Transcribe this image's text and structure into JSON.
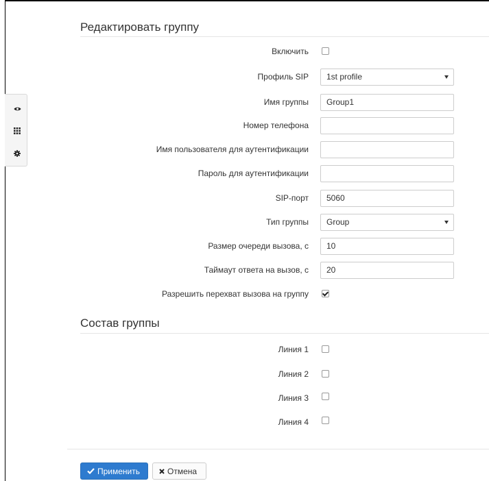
{
  "edit_group": {
    "title": "Редактировать группу",
    "fields": {
      "enable": {
        "label": "Включить",
        "checked": false
      },
      "sip_profile": {
        "label": "Профиль SIP",
        "value": "1st profile"
      },
      "group_name": {
        "label": "Имя группы",
        "value": "Group1"
      },
      "phone_number": {
        "label": "Номер телефона",
        "value": ""
      },
      "auth_username": {
        "label": "Имя пользователя для аутентификации",
        "value": ""
      },
      "auth_password": {
        "label": "Пароль для аутентификации",
        "value": ""
      },
      "sip_port": {
        "label": "SIP-порт",
        "value": "5060"
      },
      "group_type": {
        "label": "Тип группы",
        "value": "Group"
      },
      "queue_size": {
        "label": "Размер очереди вызова, с",
        "value": "10"
      },
      "answer_timeout": {
        "label": "Таймаут ответа на вызов, с",
        "value": "20"
      },
      "allow_pickup": {
        "label": "Разрешить перехват вызова на группу",
        "checked": true
      }
    }
  },
  "group_members": {
    "title": "Состав группы",
    "lines": [
      {
        "label": "Линия 1",
        "checked": false
      },
      {
        "label": "Линия 2",
        "checked": false
      },
      {
        "label": "Линия 3",
        "checked": false
      },
      {
        "label": "Линия 4",
        "checked": false
      }
    ]
  },
  "side_toolbar": {
    "icons": [
      "eye-icon",
      "grid-icon",
      "gear-icon"
    ]
  },
  "footer": {
    "apply_label": "Применить",
    "cancel_label": "Отмена"
  },
  "colors": {
    "primary": "#2e7bcf",
    "border": "#cccccc"
  }
}
